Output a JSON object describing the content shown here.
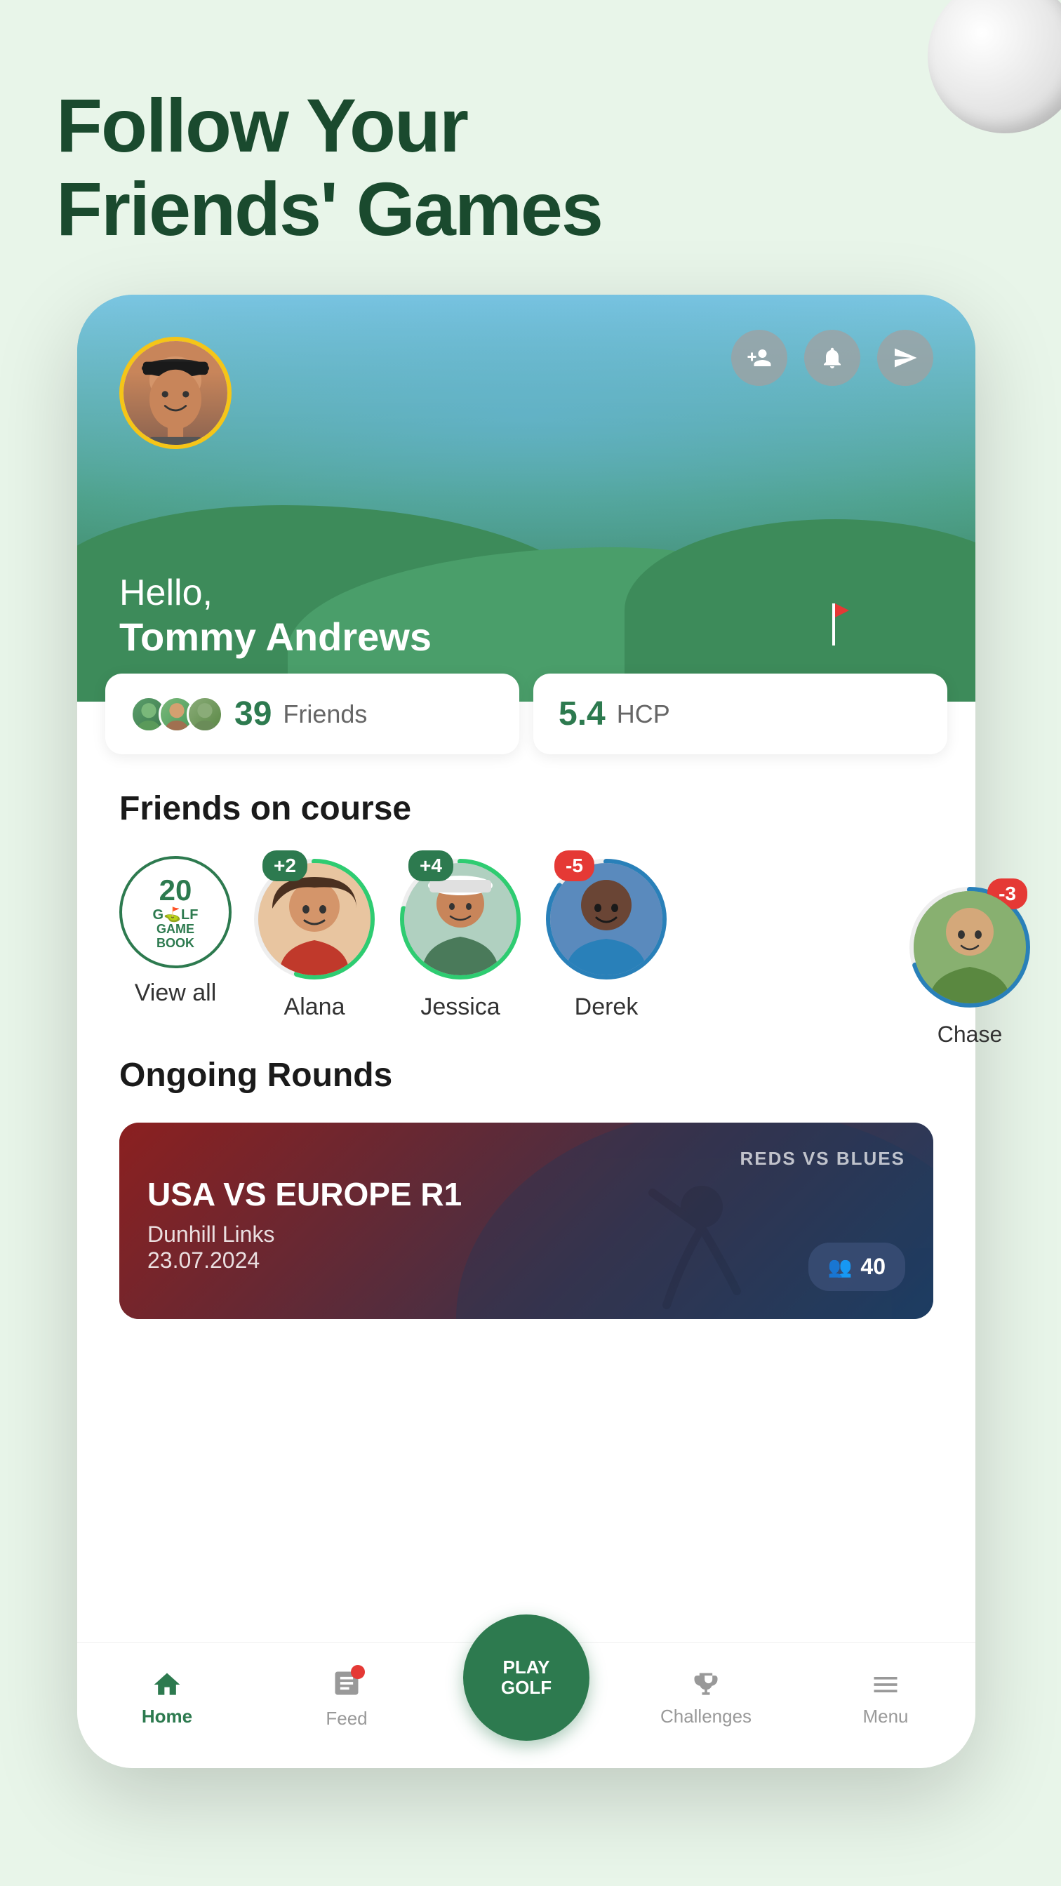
{
  "page": {
    "background_color": "#e8f5e9"
  },
  "hero": {
    "line1": "Follow Your",
    "line2": "Friends' Games",
    "bold_word": "Follow"
  },
  "profile": {
    "greeting": "Hello,",
    "name": "Tommy Andrews",
    "friends_count": "39",
    "friends_label": "Friends",
    "hcp_value": "5.4",
    "hcp_label": "HCP"
  },
  "friends_on_course": {
    "section_title": "Friends on course",
    "view_all": {
      "number": "20",
      "logo_line1": "GOLF",
      "logo_line2": "GAME",
      "logo_line3": "BOOK",
      "label": "View all"
    },
    "friends": [
      {
        "name": "Alana",
        "badge": "+2",
        "badge_color": "green",
        "ring_color": "#2ecc71",
        "ring_pct": 55
      },
      {
        "name": "Jessica",
        "badge": "+4",
        "badge_color": "green",
        "ring_color": "#2ecc71",
        "ring_pct": 78
      },
      {
        "name": "Derek",
        "badge": "-5",
        "badge_color": "red",
        "ring_color": "#2980b9",
        "ring_pct": 85
      }
    ],
    "chase": {
      "name": "Chase",
      "badge": "-3",
      "badge_color": "red"
    }
  },
  "ongoing_rounds": {
    "section_title": "Ongoing Rounds",
    "card": {
      "subtitle": "REDS VS BLUES",
      "title": "USA VS EUROPE R1",
      "course": "Dunhill Links",
      "date": "23.07.2024",
      "players": "40"
    }
  },
  "bottom_nav": {
    "items": [
      {
        "label": "Home",
        "icon": "home",
        "active": true
      },
      {
        "label": "Feed",
        "icon": "feed",
        "active": false,
        "has_badge": true
      },
      {
        "label": "PLAY\nGOLF",
        "icon": "play",
        "active": false,
        "is_cta": true
      },
      {
        "label": "Challenges",
        "icon": "trophy",
        "active": false
      },
      {
        "label": "Menu",
        "icon": "menu",
        "active": false
      }
    ]
  },
  "header_icons": [
    {
      "name": "add-friend-icon",
      "symbol": "add_friend"
    },
    {
      "name": "notification-icon",
      "symbol": "bell"
    },
    {
      "name": "share-icon",
      "symbol": "send"
    }
  ]
}
